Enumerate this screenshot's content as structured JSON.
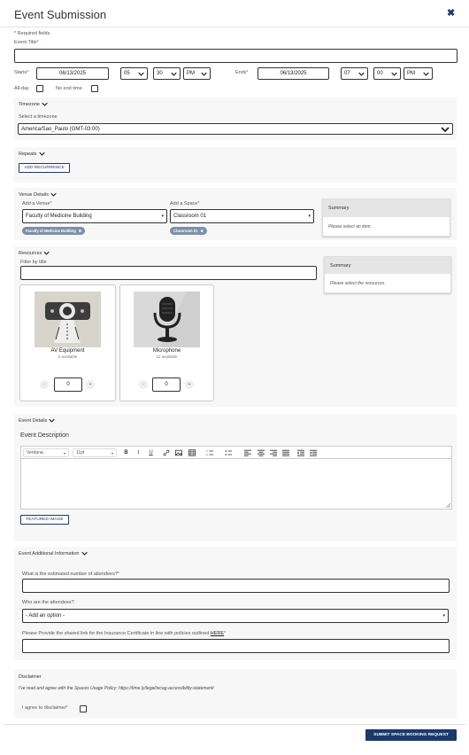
{
  "header": {
    "title": "Event Submission"
  },
  "form": {
    "required_note": "* Required fields",
    "event_title_label": "Event Title",
    "starts_label": "Starts",
    "start_date": "06/13/2025",
    "start_hour": "05",
    "start_min": "30",
    "start_ampm": "PM",
    "ends_label": "Ends",
    "end_date": "06/13/2025",
    "end_hour": "07",
    "end_min": "00",
    "end_ampm": "PM",
    "allday_label": "All-day",
    "noend_label": "No end time"
  },
  "timezone": {
    "header": "Timezone",
    "label": "Select a timezone",
    "value": "America/Sao_Paulo (GMT-03:00)"
  },
  "repeats": {
    "header": "Repeats",
    "button": "ADD RECURRENCE"
  },
  "venue": {
    "header": "Venue Details",
    "venue_label": "Add a Venue",
    "venue_value": "Faculty of Medicine Building",
    "venue_tag": "Faculty of Medicine Building",
    "space_label": "Add a Space",
    "space_value": "Classroom 01",
    "space_tag": "Classroom 01",
    "summary_title": "Summary",
    "summary_text": "Please select an item."
  },
  "resources": {
    "header": "Resources",
    "filter_label": "Filter by title",
    "summary_title": "Summary",
    "summary_text": "Please select the resources.",
    "items": [
      {
        "name": "AV Equipment",
        "avail": "5 available",
        "qty": "0",
        "minus": "-",
        "plus": "+"
      },
      {
        "name": "Microphone",
        "avail": "12 available",
        "qty": "0",
        "minus": "-",
        "plus": "+"
      }
    ]
  },
  "details": {
    "header": "Event Details",
    "desc_label": "Event Description",
    "font_value": "Verdana",
    "size_value": "11pt",
    "bold": "B",
    "italic": "I",
    "underline": "U",
    "featured_button": "FEATURED IMAGE"
  },
  "additional": {
    "header": "Event Additional Information",
    "q1": "What is the estimated number of attendees?",
    "q2": "Who are the attendees?",
    "q2_value": "- Add an option -",
    "q3": "Please Provide the shared link for the Insurance Certificate in line with policies outlined",
    "q3_link": "HERE"
  },
  "disclaimer": {
    "header": "Disclaimer",
    "text": "I've read and agree with the Spaces Usage Policy: https://time.ly/legal/wcag-accessibility-statement/",
    "agree_label": "I agree to disclaimer"
  },
  "footer": {
    "submit": "SUBMIT SPACE BOOKING REQUEST"
  },
  "colors": {
    "accent": "#1b3a6b",
    "tag": "#7d8fa9",
    "panel": "#f7f7f7"
  }
}
